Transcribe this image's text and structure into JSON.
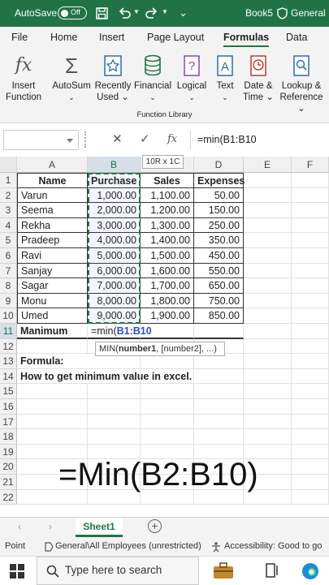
{
  "titlebar": {
    "autosave": "AutoSave",
    "toggle": "Off",
    "book": "Book5",
    "label": "General"
  },
  "tabs": [
    "File",
    "Home",
    "Insert",
    "Page Layout",
    "Formulas",
    "Data"
  ],
  "ribbon": {
    "buttons": [
      {
        "l1": "Insert",
        "l2": "Function"
      },
      {
        "l1": "AutoSum",
        "l2": ""
      },
      {
        "l1": "Recently",
        "l2": "Used"
      },
      {
        "l1": "Financial",
        "l2": ""
      },
      {
        "l1": "Logical",
        "l2": ""
      },
      {
        "l1": "Text",
        "l2": ""
      },
      {
        "l1": "Date &",
        "l2": "Time"
      },
      {
        "l1": "Lookup &",
        "l2": "Reference"
      }
    ],
    "group": "Function Library"
  },
  "formula_bar": {
    "fx": "fx",
    "value": "=min(B1:B10"
  },
  "range_badge": "10R x 1C",
  "columns": [
    "A",
    "B",
    "C",
    "D",
    "E",
    "F"
  ],
  "rows": [
    "1",
    "2",
    "3",
    "4",
    "5",
    "6",
    "7",
    "8",
    "9",
    "10",
    "11",
    "12",
    "13",
    "14",
    "15",
    "16",
    "17",
    "18",
    "19",
    "20",
    "21",
    "22"
  ],
  "table": {
    "headers": [
      "Name",
      "Purchase",
      "Sales",
      "Expenses"
    ],
    "rows": [
      [
        "Varun",
        "1,000.00",
        "1,100.00",
        "50.00"
      ],
      [
        "Seema",
        "2,000.00",
        "1,200.00",
        "150.00"
      ],
      [
        "Rekha",
        "3,000.00",
        "1,300.00",
        "250.00"
      ],
      [
        "Pradeep",
        "4,000.00",
        "1,400.00",
        "350.00"
      ],
      [
        "Ravi",
        "5,000.00",
        "1,500.00",
        "450.00"
      ],
      [
        "Sanjay",
        "6,000.00",
        "1,600.00",
        "550.00"
      ],
      [
        "Sagar",
        "7,000.00",
        "1,700.00",
        "650.00"
      ],
      [
        "Monu",
        "8,000.00",
        "1,800.00",
        "750.00"
      ],
      [
        "Umed",
        "9,000.00",
        "1,900.00",
        "850.00"
      ]
    ]
  },
  "row11": {
    "label": "Manimum",
    "formula_prefix": "=min(",
    "formula_ref": "B1:B10"
  },
  "tooltip": {
    "pre": "MIN(",
    "bold": "number1",
    ",rest": ", [number2], ...)"
  },
  "row13": "Formula:",
  "row14": "How to get minimum value in excel.",
  "big_formula": "=Min(B2:B10)",
  "sheet": "Sheet1",
  "status": {
    "mode": "Point",
    "label": "General\\All Employees (unrestricted)",
    "access": "Accessibility: Good to go"
  },
  "taskbar": {
    "search": "Type here to search"
  }
}
